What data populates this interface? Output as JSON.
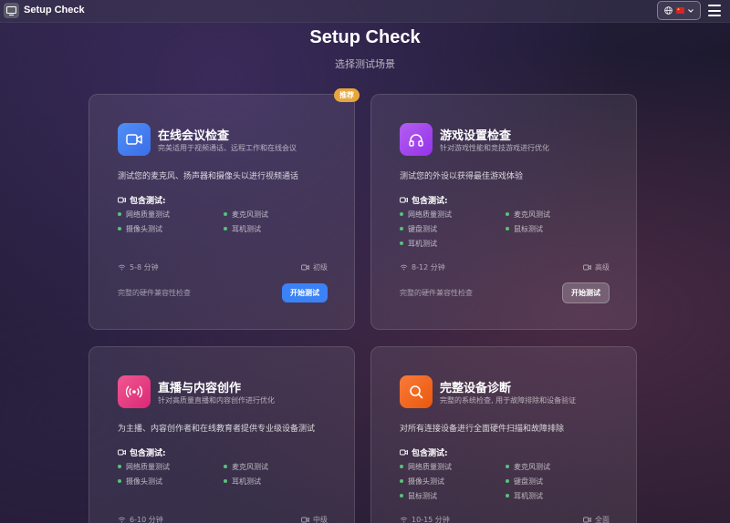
{
  "app": {
    "title": "Setup Check",
    "flag_color": "#d6242b"
  },
  "header": {
    "title": "Setup Check",
    "subtitle": "选择测试场景"
  },
  "section_label": "包含测试:",
  "cards": [
    {
      "badge": "推荐",
      "title": "在线会议检查",
      "desc": "完美适用于视频通话、远程工作和在线会议",
      "lead": "测试您的麦克风、扬声器和摄像头以进行视频通话",
      "tests": [
        "网络质量测试",
        "麦克风测试",
        "摄像头测试",
        "耳机测试"
      ],
      "duration": "5-8 分钟",
      "level": "初级",
      "compat": "完整的硬件兼容性检查",
      "button": "开始测试",
      "icon": "video-camera-icon",
      "color": "#3b82f6"
    },
    {
      "title": "游戏设置检查",
      "desc": "针对游戏性能和竞技游戏进行优化",
      "lead": "测试您的外设以获得最佳游戏体验",
      "tests": [
        "网络质量测试",
        "麦克风测试",
        "键盘测试",
        "鼠标测试",
        "耳机测试"
      ],
      "duration": "8-12 分钟",
      "level": "高级",
      "compat": "完整的硬件兼容性检查",
      "button": "开始测试",
      "icon": "headphones-icon",
      "color": "#a855f7"
    },
    {
      "title": "直播与内容创作",
      "desc": "针对高质量直播和内容创作进行优化",
      "lead": "为主播、内容创作者和在线教育者提供专业级设备测试",
      "tests": [
        "网络质量测试",
        "麦克风测试",
        "摄像头测试",
        "耳机测试"
      ],
      "duration": "6-10 分钟",
      "level": "中级",
      "icon": "broadcast-icon",
      "color": "#ec4899"
    },
    {
      "title": "完整设备诊断",
      "desc": "完整的系统检查, 用于故障排除和设备验证",
      "lead": "对所有连接设备进行全面硬件扫描和故障排除",
      "tests": [
        "网络质量测试",
        "麦克风测试",
        "摄像头测试",
        "键盘测试",
        "鼠标测试",
        "耳机测试"
      ],
      "duration": "10-15 分钟",
      "level": "全面",
      "icon": "search-icon",
      "color": "#f97316"
    }
  ]
}
